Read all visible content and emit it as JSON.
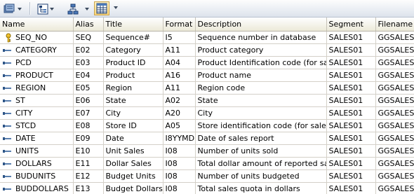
{
  "toolbar": {
    "icons": [
      "options-icon",
      "hierarchy-icon",
      "relations-icon",
      "grid-view-icon"
    ],
    "selected": "grid-view-icon"
  },
  "columns": [
    "Name",
    "Alias",
    "Title",
    "Format",
    "Description",
    "Segment",
    "Filename"
  ],
  "rows": [
    {
      "name": "SEQ_NO",
      "alias": "SEQ",
      "title": "Sequence#",
      "format": "I5",
      "description": "Sequence number in database",
      "segment": "SALES01",
      "filename": "GGSALES",
      "icon": "key-icon"
    },
    {
      "name": "CATEGORY",
      "alias": "E02",
      "title": "Category",
      "format": "A11",
      "description": "Product category",
      "segment": "SALES01",
      "filename": "GGSALES",
      "icon": "field-icon"
    },
    {
      "name": "PCD",
      "alias": "E03",
      "title": "Product ID",
      "format": "A04",
      "description": "Product Identification code (for sale)",
      "segment": "SALES01",
      "filename": "GGSALES",
      "icon": "field-icon"
    },
    {
      "name": "PRODUCT",
      "alias": "E04",
      "title": "Product",
      "format": "A16",
      "description": "Product name",
      "segment": "SALES01",
      "filename": "GGSALES",
      "icon": "field-icon"
    },
    {
      "name": "REGION",
      "alias": "E05",
      "title": "Region",
      "format": "A11",
      "description": "Region code",
      "segment": "SALES01",
      "filename": "GGSALES",
      "icon": "field-icon"
    },
    {
      "name": "ST",
      "alias": "E06",
      "title": "State",
      "format": "A02",
      "description": "State",
      "segment": "SALES01",
      "filename": "GGSALES",
      "icon": "field-icon"
    },
    {
      "name": "CITY",
      "alias": "E07",
      "title": "City",
      "format": "A20",
      "description": "City",
      "segment": "SALES01",
      "filename": "GGSALES",
      "icon": "field-icon"
    },
    {
      "name": "STCD",
      "alias": "E08",
      "title": "Store ID",
      "format": "A05",
      "description": "Store identification code (for sale)",
      "segment": "SALES01",
      "filename": "GGSALES",
      "icon": "field-icon"
    },
    {
      "name": "DATE",
      "alias": "E09",
      "title": "Date",
      "format": "I8YYMD",
      "description": "Date of sales report",
      "segment": "SALES01",
      "filename": "GGSALES",
      "icon": "field-icon"
    },
    {
      "name": "UNITS",
      "alias": "E10",
      "title": "Unit Sales",
      "format": "I08",
      "description": "Number of units sold",
      "segment": "SALES01",
      "filename": "GGSALES",
      "icon": "field-icon"
    },
    {
      "name": "DOLLARS",
      "alias": "E11",
      "title": "Dollar Sales",
      "format": "I08",
      "description": "Total dollar amount of reported sales",
      "segment": "SALES01",
      "filename": "GGSALES",
      "icon": "field-icon"
    },
    {
      "name": "BUDUNITS",
      "alias": "E12",
      "title": "Budget Units",
      "format": "I08",
      "description": "Number of units budgeted",
      "segment": "SALES01",
      "filename": "GGSALES",
      "icon": "field-icon"
    },
    {
      "name": "BUDDOLLARS",
      "alias": "E13",
      "title": "Budget Dollars",
      "format": "I08",
      "description": "Total sales quota in dollars",
      "segment": "SALES01",
      "filename": "GGSALES",
      "icon": "field-icon"
    }
  ]
}
